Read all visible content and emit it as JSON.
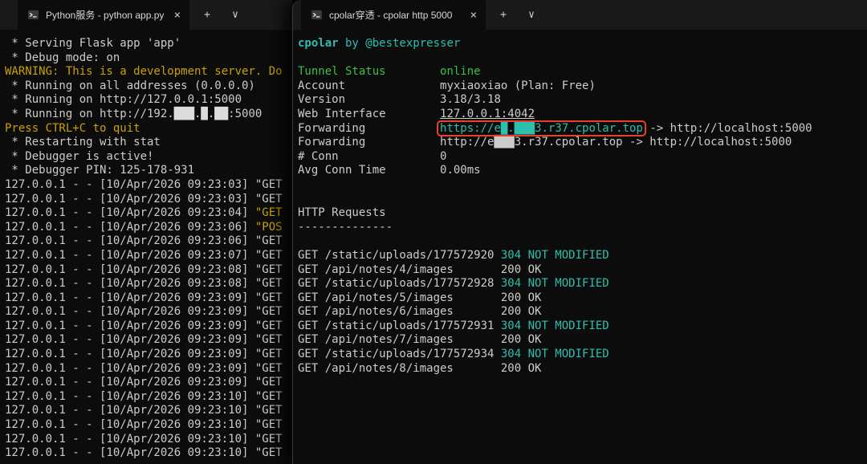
{
  "colors": {
    "term_bg": "#0c0c0c",
    "tabbar_bg": "#191919",
    "tab_text": "#d6d6d6",
    "fg": "#cccccc",
    "yellow": "#c9a100",
    "teal": "#2cbfae",
    "green": "#39c047",
    "red_box": "#e8402a"
  },
  "left_window": {
    "tab": {
      "title": "Python服务 - python  app.py",
      "close_icon": "×"
    },
    "new_tab_icon": "+",
    "dropdown_icon": "∨",
    "terminal": {
      "lines": [
        {
          "s": [
            {
              "t": " * Serving Flask app 'app'"
            }
          ]
        },
        {
          "s": [
            {
              "t": " * Debug mode: on"
            }
          ]
        },
        {
          "s": [
            {
              "t": "WARNING: This is a development server. Do",
              "c": "fg-yellow"
            }
          ]
        },
        {
          "s": [
            {
              "t": " * Running on all addresses (0.0.0.0)"
            }
          ]
        },
        {
          "s": [
            {
              "t": " * Running on http://127.0.0.1:5000"
            }
          ]
        },
        {
          "s": [
            {
              "t": " * Running on http://192."
            },
            {
              "t": "███.█.██",
              "c": "redact"
            },
            {
              "t": ":5000"
            }
          ]
        },
        {
          "s": [
            {
              "t": "Press CTRL+C to quit",
              "c": "fg-yellow"
            }
          ]
        },
        {
          "s": [
            {
              "t": " * Restarting with stat"
            }
          ]
        },
        {
          "s": [
            {
              "t": " * Debugger is active!"
            }
          ]
        },
        {
          "s": [
            {
              "t": " * Debugger PIN: 125-178-931"
            }
          ]
        },
        {
          "s": [
            {
              "t": "127.0.0.1 - - [10/Apr/2026 09:23:03] "
            },
            {
              "t": "\"GET"
            }
          ]
        },
        {
          "s": [
            {
              "t": "127.0.0.1 - - [10/Apr/2026 09:23:03] "
            },
            {
              "t": "\"GET"
            }
          ]
        },
        {
          "s": [
            {
              "t": "127.0.0.1 - - [10/Apr/2026 09:23:04] "
            },
            {
              "t": "\"GET",
              "c": "fg-yellow"
            }
          ]
        },
        {
          "s": [
            {
              "t": "127.0.0.1 - - [10/Apr/2026 09:23:06] "
            },
            {
              "t": "\"POS",
              "c": "fg-yellow"
            }
          ]
        },
        {
          "s": [
            {
              "t": "127.0.0.1 - - [10/Apr/2026 09:23:06] "
            },
            {
              "t": "\"GET"
            }
          ]
        },
        {
          "s": [
            {
              "t": "127.0.0.1 - - [10/Apr/2026 09:23:07] "
            },
            {
              "t": "\"GET"
            }
          ]
        },
        {
          "s": [
            {
              "t": "127.0.0.1 - - [10/Apr/2026 09:23:08] "
            },
            {
              "t": "\"GET"
            }
          ]
        },
        {
          "s": [
            {
              "t": "127.0.0.1 - - [10/Apr/2026 09:23:08] "
            },
            {
              "t": "\"GET"
            }
          ]
        },
        {
          "s": [
            {
              "t": "127.0.0.1 - - [10/Apr/2026 09:23:09] "
            },
            {
              "t": "\"GET"
            }
          ]
        },
        {
          "s": [
            {
              "t": "127.0.0.1 - - [10/Apr/2026 09:23:09] "
            },
            {
              "t": "\"GET"
            }
          ]
        },
        {
          "s": [
            {
              "t": "127.0.0.1 - - [10/Apr/2026 09:23:09] "
            },
            {
              "t": "\"GET"
            }
          ]
        },
        {
          "s": [
            {
              "t": "127.0.0.1 - - [10/Apr/2026 09:23:09] "
            },
            {
              "t": "\"GET"
            }
          ]
        },
        {
          "s": [
            {
              "t": "127.0.0.1 - - [10/Apr/2026 09:23:09] "
            },
            {
              "t": "\"GET"
            }
          ]
        },
        {
          "s": [
            {
              "t": "127.0.0.1 - - [10/Apr/2026 09:23:09] "
            },
            {
              "t": "\"GET"
            }
          ]
        },
        {
          "s": [
            {
              "t": "127.0.0.1 - - [10/Apr/2026 09:23:09] "
            },
            {
              "t": "\"GET"
            }
          ]
        },
        {
          "s": [
            {
              "t": "127.0.0.1 - - [10/Apr/2026 09:23:10] "
            },
            {
              "t": "\"GET"
            }
          ]
        },
        {
          "s": [
            {
              "t": "127.0.0.1 - - [10/Apr/2026 09:23:10] "
            },
            {
              "t": "\"GET"
            }
          ]
        },
        {
          "s": [
            {
              "t": "127.0.0.1 - - [10/Apr/2026 09:23:10] "
            },
            {
              "t": "\"GET"
            }
          ]
        },
        {
          "s": [
            {
              "t": "127.0.0.1 - - [10/Apr/2026 09:23:10] "
            },
            {
              "t": "\"GET"
            }
          ]
        },
        {
          "s": [
            {
              "t": "127.0.0.1 - - [10/Apr/2026 09:23:10] "
            },
            {
              "t": "\"GET"
            }
          ]
        }
      ]
    }
  },
  "right_window": {
    "tab": {
      "title": "cpolar穿透 - cpolar  http 5000",
      "close_icon": "×"
    },
    "new_tab_icon": "+",
    "dropdown_icon": "∨",
    "terminal": {
      "lines": [
        {
          "s": [
            {
              "t": "cpolar",
              "c": "fg-teal bold"
            },
            {
              "t": " by @bestexpresser",
              "c": "fg-teal"
            }
          ]
        },
        {
          "s": []
        },
        {
          "s": [
            {
              "t": "Tunnel Status        ",
              "c": "fg-green"
            },
            {
              "t": "online",
              "c": "fg-green"
            }
          ]
        },
        {
          "s": [
            {
              "t": "Account              "
            },
            {
              "t": "myxiaoxiao (Plan: Free)"
            }
          ]
        },
        {
          "s": [
            {
              "t": "Version              "
            },
            {
              "t": "3.18/3.18"
            }
          ]
        },
        {
          "s": [
            {
              "t": "Web Interface        "
            },
            {
              "t": "127.0.0.1:4042",
              "c": "underline",
              "n": "web-interface-address"
            }
          ]
        },
        {
          "s": [
            {
              "t": "Forwarding           "
            },
            {
              "t": "https://e█.███3.r37.cpolar.top",
              "c": "fg-teal highlight-box",
              "n": "forwarding-url-https"
            },
            {
              "t": " -> http://localhost:5000"
            }
          ]
        },
        {
          "s": [
            {
              "t": "Forwarding           "
            },
            {
              "t": "http://e███3.r37.cpolar.top -> http://localhost:5000",
              "n": "forwarding-url-http"
            }
          ]
        },
        {
          "s": [
            {
              "t": "# Conn               "
            },
            {
              "t": "0"
            }
          ]
        },
        {
          "s": [
            {
              "t": "Avg Conn Time        "
            },
            {
              "t": "0.00ms"
            }
          ]
        },
        {
          "s": []
        },
        {
          "s": []
        },
        {
          "s": [
            {
              "t": "HTTP Requests"
            }
          ]
        },
        {
          "s": [
            {
              "t": "--------------"
            }
          ]
        },
        {
          "s": []
        },
        {
          "s": [
            {
              "t": "GET /static/uploads/177572920 "
            },
            {
              "t": "304 NOT MODIFIED",
              "c": "fg-teal"
            }
          ]
        },
        {
          "s": [
            {
              "t": "GET /api/notes/4/images       "
            },
            {
              "t": "200 OK"
            }
          ]
        },
        {
          "s": [
            {
              "t": "GET /static/uploads/177572928 "
            },
            {
              "t": "304 NOT MODIFIED",
              "c": "fg-teal"
            }
          ]
        },
        {
          "s": [
            {
              "t": "GET /api/notes/5/images       "
            },
            {
              "t": "200 OK"
            }
          ]
        },
        {
          "s": [
            {
              "t": "GET /api/notes/6/images       "
            },
            {
              "t": "200 OK"
            }
          ]
        },
        {
          "s": [
            {
              "t": "GET /static/uploads/177572931 "
            },
            {
              "t": "304 NOT MODIFIED",
              "c": "fg-teal"
            }
          ]
        },
        {
          "s": [
            {
              "t": "GET /api/notes/7/images       "
            },
            {
              "t": "200 OK"
            }
          ]
        },
        {
          "s": [
            {
              "t": "GET /static/uploads/177572934 "
            },
            {
              "t": "304 NOT MODIFIED",
              "c": "fg-teal"
            }
          ]
        },
        {
          "s": [
            {
              "t": "GET /api/notes/8/images       "
            },
            {
              "t": "200 OK"
            }
          ]
        }
      ]
    }
  }
}
